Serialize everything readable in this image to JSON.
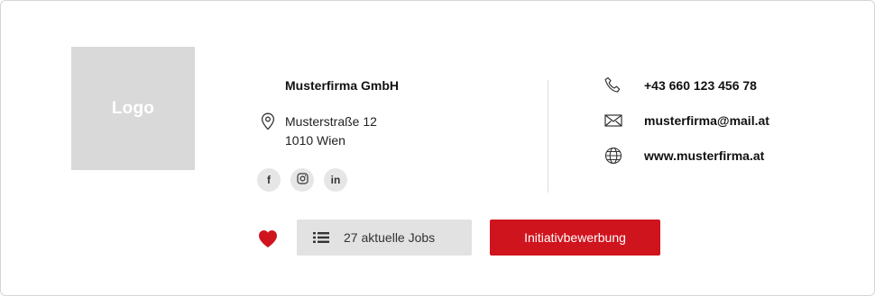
{
  "logo": {
    "text": "Logo"
  },
  "company": {
    "name": "Musterfirma GmbH",
    "address": {
      "street": "Musterstraße 12",
      "city": "1010 Wien"
    }
  },
  "social": [
    {
      "label": "f",
      "icon": "facebook-icon"
    },
    {
      "label": "◎",
      "icon": "instagram-icon"
    },
    {
      "label": "in",
      "icon": "linkedin-icon"
    }
  ],
  "contact": {
    "phone": "+43 660 123 456 78",
    "email": "musterfirma@mail.at",
    "website": "www.musterfirma.at"
  },
  "actions": {
    "jobs_label": "27 aktuelle Jobs",
    "apply_label": "Initiativbewerbung"
  },
  "colors": {
    "accent": "#d0141e",
    "logo_bg": "#d9d9d9",
    "button_gray": "#e2e2e2"
  }
}
